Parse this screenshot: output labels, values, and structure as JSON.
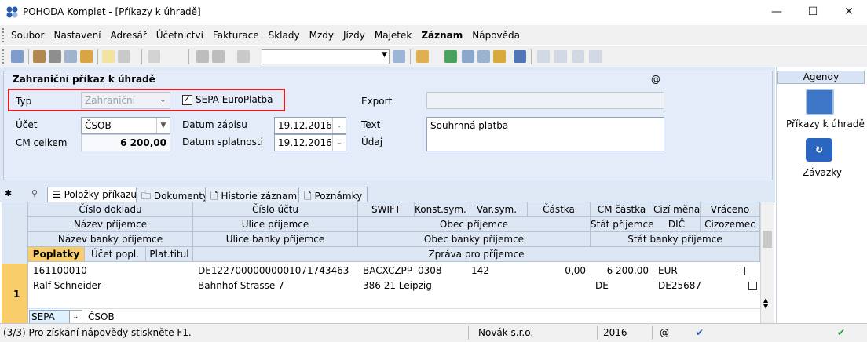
{
  "window": {
    "title": "POHODA Komplet - [Příkazy k úhradě]",
    "minimize": "—",
    "maximize": "☐",
    "close": "✕"
  },
  "menu": [
    "Soubor",
    "Nastavení",
    "Adresář",
    "Účetnictví",
    "Fakturace",
    "Sklady",
    "Mzdy",
    "Jízdy",
    "Majetek",
    "Záznam",
    "Nápověda"
  ],
  "form": {
    "title": "Zahraniční příkaz k úhradě",
    "at": "@",
    "typ_label": "Typ",
    "typ_value": "Zahraniční",
    "sepa_label": "SEPA EuroPlatba",
    "sepa_checked": true,
    "export_label": "Export",
    "export_value": "",
    "ucet_label": "Účet",
    "ucet_value": "ČSOB",
    "cm_label": "CM celkem",
    "cm_value": "6 200,00",
    "datum_zapisu_label": "Datum zápisu",
    "datum_zapisu": "19.12.2016",
    "datum_splatnosti_label": "Datum splatnosti",
    "datum_splatnosti": "19.12.2016",
    "text_label": "Text",
    "text_value": "Souhrnná platba",
    "udaj_label": "Údaj",
    "udaj_value": ""
  },
  "agendy": {
    "header": "Agendy",
    "items": [
      {
        "label": "Příkazy k úhradě"
      },
      {
        "label": "Závazky"
      }
    ]
  },
  "tabs": [
    {
      "label": "Položky příkazu"
    },
    {
      "label": "Dokumenty"
    },
    {
      "label": "Historie záznamu"
    },
    {
      "label": "Poznámky"
    }
  ],
  "grid": {
    "h1": [
      "Číslo dokladu",
      "Číslo účtu",
      "SWIFT",
      "Konst.sym.",
      "Var.sym.",
      "Částka",
      "CM částka",
      "Cizí měna",
      "Vráceno"
    ],
    "h2": [
      "Název příjemce",
      "Ulice příjemce",
      "Obec příjemce",
      "Stát příjemce",
      "DIČ",
      "Cizozemec"
    ],
    "h3": [
      "Název banky příjemce",
      "Ulice banky příjemce",
      "Obec banky příjemce",
      "Stát banky příjemce"
    ],
    "h4": [
      "Poplatky",
      "Účet popl.",
      "Plat.titul",
      "Zpráva pro příjemce"
    ],
    "row_number": "1",
    "r1": {
      "cislo_dokladu": "161100010",
      "cislo_uctu": "DE12270000000001071743463",
      "swift": "BACXCZPP",
      "konst": "0308",
      "var": "142",
      "castka": "0,00",
      "cm_castka": "6 200,00",
      "mena": "EUR"
    },
    "r2": {
      "nazev": "Ralf Schneider",
      "ulice": "Bahnhof Strasse 7",
      "obec": "386 21 Leipzig",
      "stat": "DE",
      "dic": "DE25687"
    },
    "r4": {
      "poplatky": "SEPA",
      "ucet_popl": "ČSOB"
    }
  },
  "status": {
    "help": "(3/3) Pro získání nápovědy stiskněte F1.",
    "company": "Novák s.r.o.",
    "year": "2016",
    "at": "@"
  },
  "colors": {
    "accent": "#dfe8f5",
    "highlight": "#f8cd6a",
    "red": "#e02020"
  }
}
